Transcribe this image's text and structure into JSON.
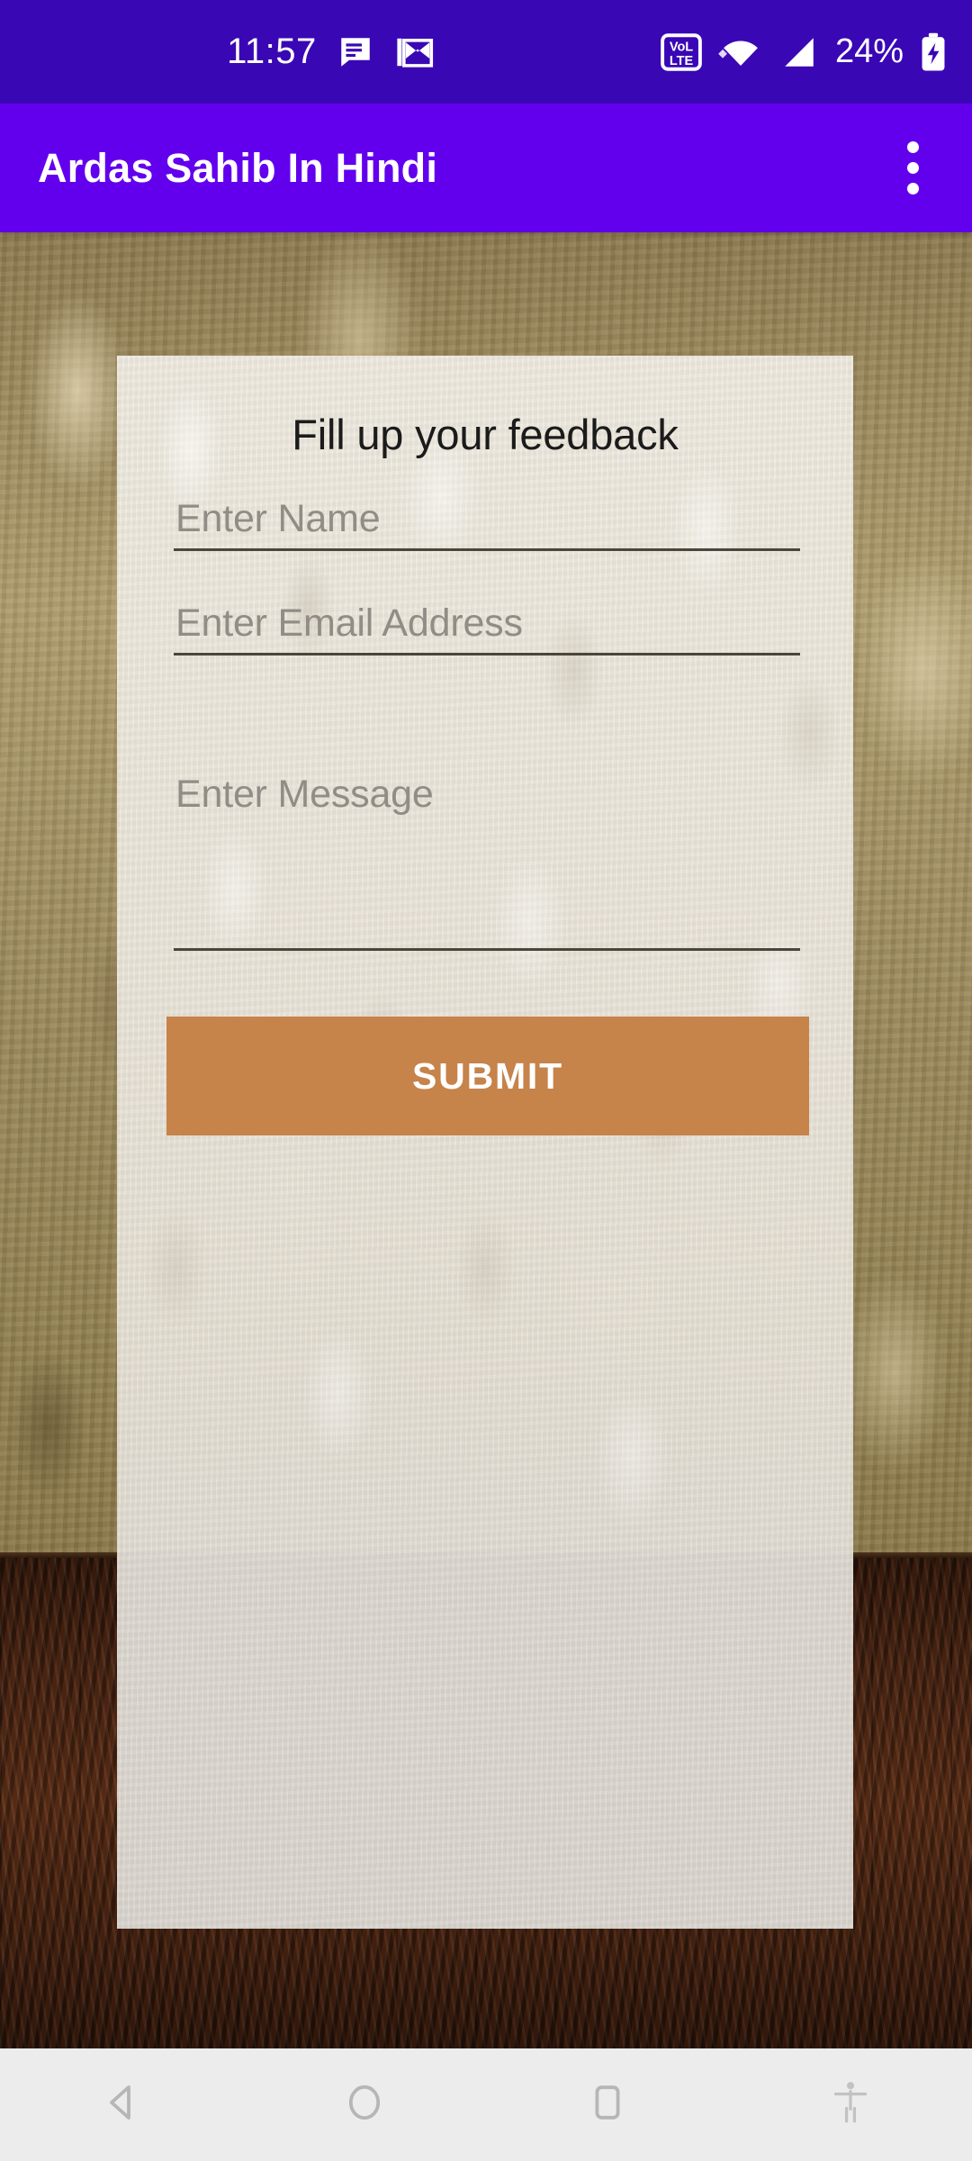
{
  "status_bar": {
    "clock": "11:57",
    "battery_percent": "24%",
    "icons": [
      "message-icon",
      "gmail-icon",
      "volte-icon",
      "wifi-icon",
      "cellular-signal-icon",
      "battery-charging-icon"
    ],
    "volte_top_label": "VoL",
    "volte_bottom_label": "LTE",
    "background_color": "#3A07B5"
  },
  "app_bar": {
    "title": "Ardas Sahib In Hindi",
    "overflow_menu_label": "More options",
    "background_color": "#6200EE",
    "title_color": "#FFFFFF"
  },
  "feedback_card": {
    "heading": "Fill up your feedback",
    "fields": [
      {
        "name": "name",
        "placeholder": "Enter Name"
      },
      {
        "name": "email",
        "placeholder": "Enter Email Address"
      },
      {
        "name": "message",
        "placeholder": "Enter Message"
      }
    ],
    "submit_label": "SUBMIT",
    "submit_color": "#C6834A",
    "submit_text_color": "#FFFFFF",
    "placeholder_color": "#918D86",
    "underline_color": "#4C4539",
    "heading_color": "#1B1B1B",
    "panel_color": "#ECE8DE"
  },
  "background": {
    "wall_color": "#A3905F",
    "floor_color": "#4A2412",
    "description": "textured golden plaster wall above dark wood plank floor"
  },
  "nav_bar": {
    "background_color": "#ECECEC",
    "buttons": [
      {
        "name": "back",
        "icon": "back-triangle-icon"
      },
      {
        "name": "home",
        "icon": "home-circle-icon"
      },
      {
        "name": "recents",
        "icon": "recents-square-icon"
      },
      {
        "name": "accessibility",
        "icon": "accessibility-icon"
      }
    ]
  }
}
